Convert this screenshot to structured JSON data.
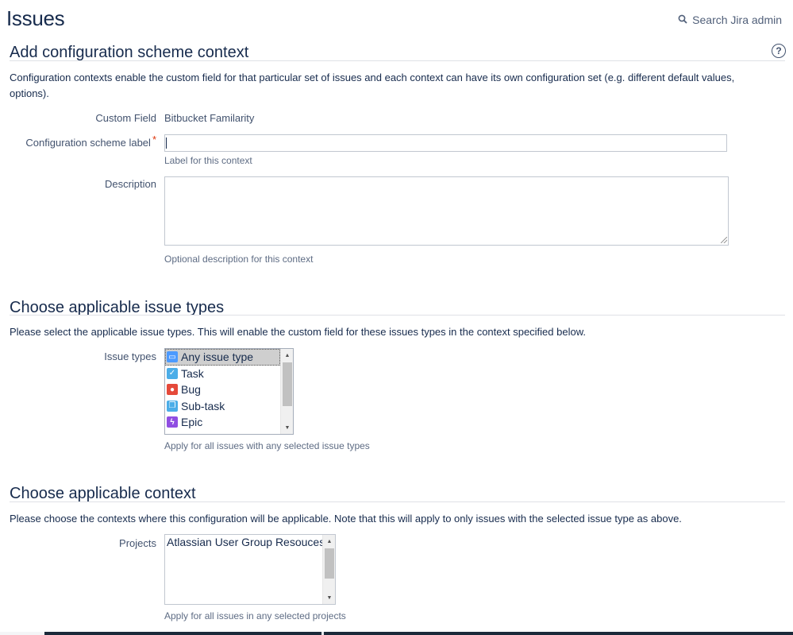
{
  "page": {
    "title": "Issues",
    "search_label": "Search Jira admin"
  },
  "section1": {
    "title": "Add configuration scheme context",
    "help": "?",
    "description": "Configuration contexts enable the custom field for that particular set of issues and each context can have its own configuration set (e.g. different default values, options).",
    "custom_field_label": "Custom Field",
    "custom_field_value": "Bitbucket Familarity",
    "scheme_label_label": "Configuration scheme label",
    "scheme_label_required": "*",
    "scheme_label_value": "",
    "scheme_label_hint": "Label for this context",
    "description_label": "Description",
    "description_value": "",
    "description_hint": "Optional description for this context"
  },
  "section2": {
    "title": "Choose applicable issue types",
    "description": "Please select the applicable issue types. This will enable the custom field for these issues types in the context specified below.",
    "issue_types_label": "Issue types",
    "issue_types": [
      {
        "label": "Any issue type",
        "icon": "any-issue-type-icon",
        "color": "#4c9aff",
        "selected": true
      },
      {
        "label": "Task",
        "icon": "task-icon",
        "color": "#4bade8",
        "selected": false
      },
      {
        "label": "Bug",
        "icon": "bug-icon",
        "color": "#e5493a",
        "selected": false
      },
      {
        "label": "Sub-task",
        "icon": "subtask-icon",
        "color": "#4bade8",
        "selected": false
      },
      {
        "label": "Epic",
        "icon": "epic-icon",
        "color": "#904ee2",
        "selected": false
      }
    ],
    "issue_types_hint": "Apply for all issues with any selected issue types"
  },
  "section3": {
    "title": "Choose applicable context",
    "description": "Please choose the contexts where this configuration will be applicable. Note that this will apply to only issues with the selected issue type as above.",
    "projects_label": "Projects",
    "projects": [
      "Atlassian User Group Resouces"
    ],
    "projects_hint": "Apply for all issues in any selected projects"
  }
}
